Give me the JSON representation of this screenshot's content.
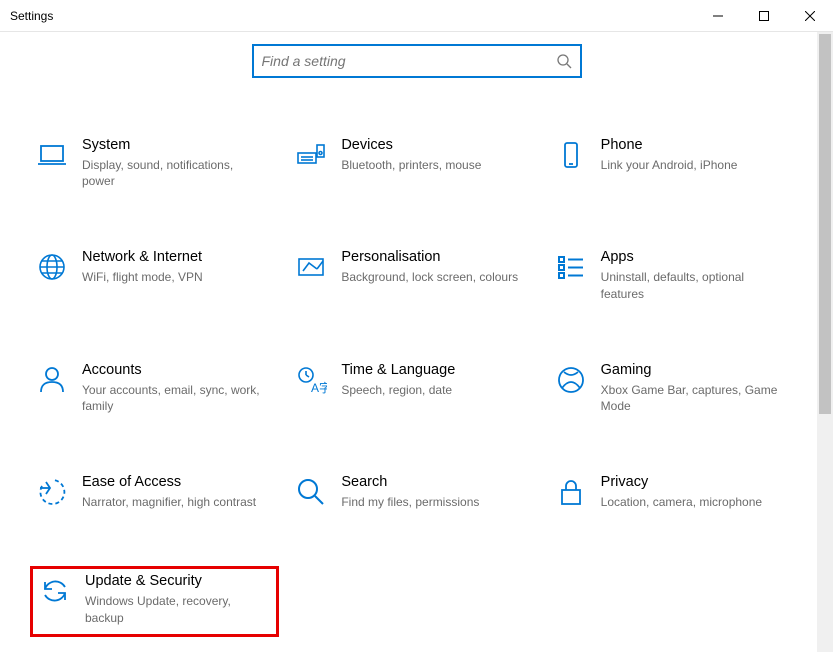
{
  "window": {
    "title": "Settings"
  },
  "search": {
    "placeholder": "Find a setting"
  },
  "tiles": [
    {
      "key": "system",
      "title": "System",
      "desc": "Display, sound, notifications, power"
    },
    {
      "key": "devices",
      "title": "Devices",
      "desc": "Bluetooth, printers, mouse"
    },
    {
      "key": "phone",
      "title": "Phone",
      "desc": "Link your Android, iPhone"
    },
    {
      "key": "network",
      "title": "Network & Internet",
      "desc": "WiFi, flight mode, VPN"
    },
    {
      "key": "personalisation",
      "title": "Personalisation",
      "desc": "Background, lock screen, colours"
    },
    {
      "key": "apps",
      "title": "Apps",
      "desc": "Uninstall, defaults, optional features"
    },
    {
      "key": "accounts",
      "title": "Accounts",
      "desc": "Your accounts, email, sync, work, family"
    },
    {
      "key": "time",
      "title": "Time & Language",
      "desc": "Speech, region, date"
    },
    {
      "key": "gaming",
      "title": "Gaming",
      "desc": "Xbox Game Bar, captures, Game Mode"
    },
    {
      "key": "ease",
      "title": "Ease of Access",
      "desc": "Narrator, magnifier, high contrast"
    },
    {
      "key": "search",
      "title": "Search",
      "desc": "Find my files, permissions"
    },
    {
      "key": "privacy",
      "title": "Privacy",
      "desc": "Location, camera, microphone"
    },
    {
      "key": "update",
      "title": "Update & Security",
      "desc": "Windows Update, recovery, backup"
    }
  ],
  "highlighted_key": "update",
  "colors": {
    "accent": "#0078d4",
    "highlight": "#e60000"
  }
}
